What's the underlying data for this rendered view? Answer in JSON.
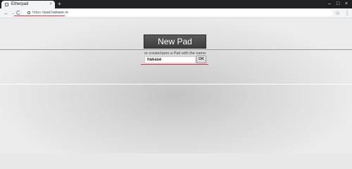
{
  "browser": {
    "tab": {
      "title": "Etherpad",
      "close": "×"
    },
    "new_tab": "+",
    "window_controls": {
      "minimize": "–",
      "maximize": "□",
      "close": "×"
    },
    "nav": {
      "back": "←",
      "forward": "→",
      "reload": "C"
    },
    "url": {
      "scheme": "https://",
      "host": "pad.hakase.io"
    },
    "star": "☆",
    "menu": "⋮"
  },
  "page": {
    "new_pad_label": "New Pad",
    "or_label": "or create/open a Pad with the name:",
    "pad_name_value": "hakase",
    "ok_label": "OK"
  },
  "colors": {
    "highlight": "#e6324a",
    "button_dark": "#4a4a4a"
  }
}
